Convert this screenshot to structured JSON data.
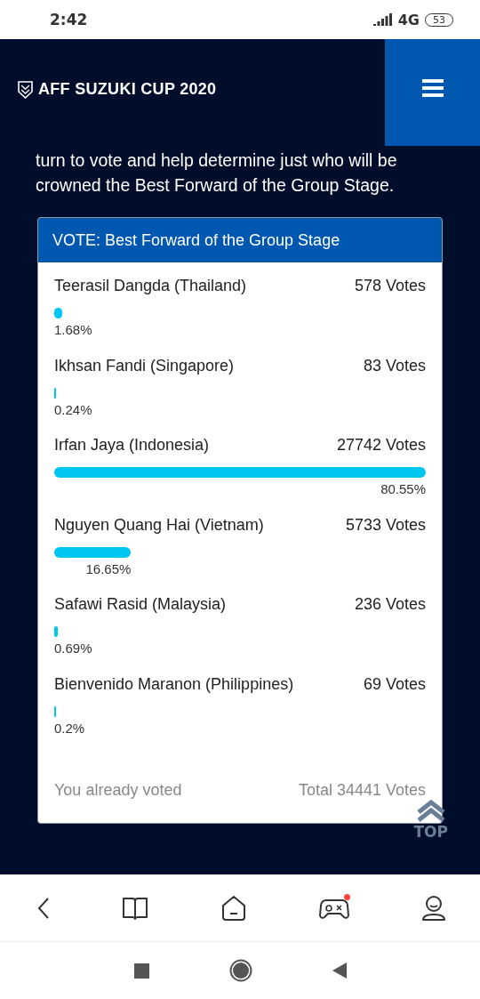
{
  "status_bar": {
    "time": "2:42",
    "network": "4G",
    "battery": "53"
  },
  "header": {
    "logo_text": "AFF SUZUKI CUP 2020"
  },
  "intro": "turn to vote and help determine just who will be crowned the Best Forward of the Group Stage.",
  "poll": {
    "title": "VOTE: Best Forward of the Group Stage",
    "options": [
      {
        "name": "Teerasil Dangda (Thailand)",
        "votes": "578 Votes",
        "percent": "1.68%"
      },
      {
        "name": "Ikhsan Fandi (Singapore)",
        "votes": "83 Votes",
        "percent": "0.24%"
      },
      {
        "name": "Irfan Jaya (Indonesia)",
        "votes": "27742 Votes",
        "percent": "80.55%"
      },
      {
        "name": "Nguyen Quang Hai (Vietnam)",
        "votes": "5733 Votes",
        "percent": "16.65%"
      },
      {
        "name": "Safawi Rasid (Malaysia)",
        "votes": "236 Votes",
        "percent": "0.69%"
      },
      {
        "name": "Bienvenido Maranon (Philippines)",
        "votes": "69 Votes",
        "percent": "0.2%"
      }
    ],
    "status": "You already voted",
    "total": "Total 34441 Votes"
  },
  "top_button": {
    "label": "TOP"
  }
}
